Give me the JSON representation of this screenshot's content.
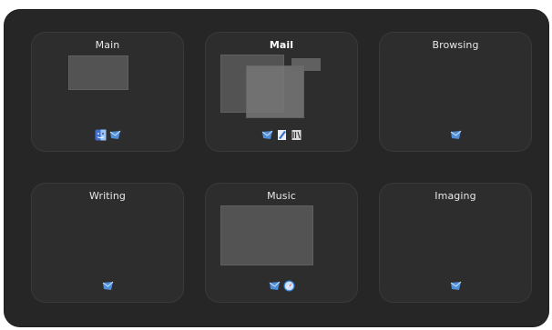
{
  "spaces": [
    {
      "name": "Main",
      "active": false,
      "icons": [
        "finder-icon",
        "mail-app-icon"
      ]
    },
    {
      "name": "Mail",
      "active": true,
      "icons": [
        "mail-app-icon",
        "textedit-icon",
        "script-editor-icon"
      ]
    },
    {
      "name": "Browsing",
      "active": false,
      "icons": [
        "mail-app-icon"
      ]
    },
    {
      "name": "Writing",
      "active": false,
      "icons": [
        "mail-app-icon"
      ]
    },
    {
      "name": "Music",
      "active": false,
      "icons": [
        "mail-app-icon",
        "safari-icon"
      ]
    },
    {
      "name": "Imaging",
      "active": false,
      "icons": [
        "mail-app-icon"
      ]
    }
  ],
  "colors": {
    "panel_bg": "#262626",
    "space_bg": "#2d2d2d",
    "window_thumb": "#5a5a5a"
  }
}
